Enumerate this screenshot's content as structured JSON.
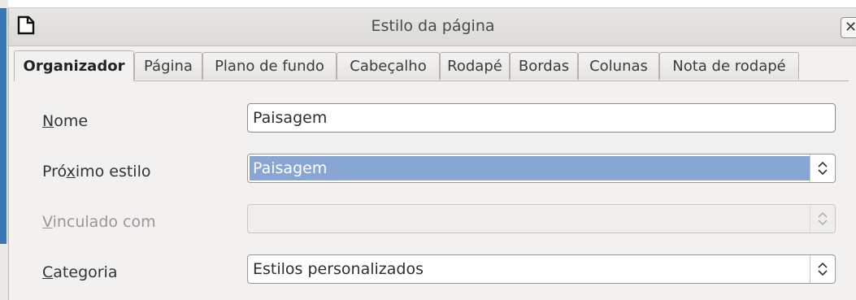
{
  "dialog": {
    "title": "Estilo da página"
  },
  "tabs": [
    {
      "label": "Organizador",
      "active": true
    },
    {
      "label": "Página"
    },
    {
      "label": "Plano de fundo"
    },
    {
      "label": "Cabeçalho"
    },
    {
      "label": "Rodapé"
    },
    {
      "label": "Bordas"
    },
    {
      "label": "Colunas"
    },
    {
      "label": "Nota de rodapé"
    }
  ],
  "form": {
    "nome_label_first": "N",
    "nome_label_rest": "ome",
    "nome_value": "Paisagem",
    "proximo_label_a": "Pró",
    "proximo_label_u": "x",
    "proximo_label_b": "imo estilo",
    "proximo_value": "Paisagem",
    "vinculado_label_first": "V",
    "vinculado_label_rest": "inculado com",
    "vinculado_value": "",
    "categoria_label_first": "C",
    "categoria_label_rest": "ategoria",
    "categoria_value": "Estilos personalizados"
  },
  "icons": {
    "document": "document-icon",
    "close": "close-icon",
    "spin": "up-down-arrows-icon"
  },
  "colors": {
    "selection": "#87a6d3",
    "background": "#f2f1f0"
  }
}
